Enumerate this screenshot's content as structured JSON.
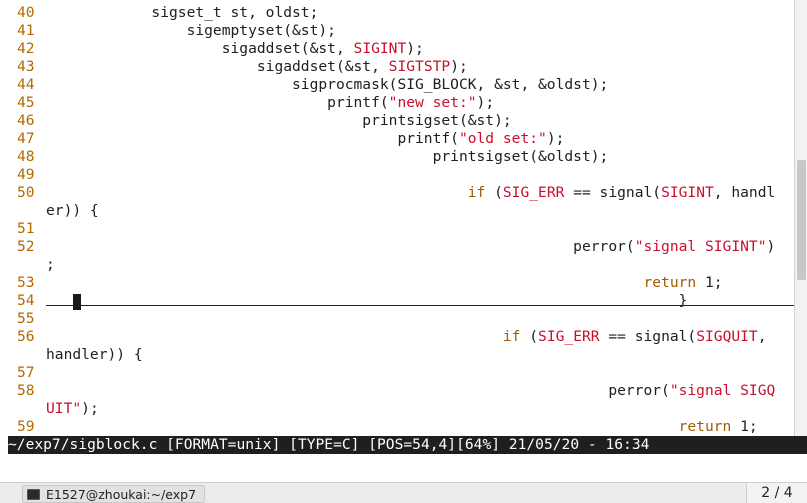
{
  "editor": {
    "lines": [
      {
        "n": "40",
        "parts": [
          {
            "t": "            sigset_t st, oldst;",
            "c": ""
          }
        ]
      },
      {
        "n": "41",
        "parts": [
          {
            "t": "                sigemptyset(&st);",
            "c": ""
          }
        ]
      },
      {
        "n": "42",
        "parts": [
          {
            "t": "                    sigaddset(&st, ",
            "c": ""
          },
          {
            "t": "SIGINT",
            "c": "s"
          },
          {
            "t": ");",
            "c": ""
          }
        ]
      },
      {
        "n": "43",
        "parts": [
          {
            "t": "                        sigaddset(&st, ",
            "c": ""
          },
          {
            "t": "SIGTSTP",
            "c": "s"
          },
          {
            "t": ");",
            "c": ""
          }
        ]
      },
      {
        "n": "44",
        "parts": [
          {
            "t": "                            sigprocmask(SIG_BLOCK, &st, &oldst);",
            "c": ""
          }
        ]
      },
      {
        "n": "45",
        "parts": [
          {
            "t": "                                printf(",
            "c": ""
          },
          {
            "t": "\"new set:\"",
            "c": "s"
          },
          {
            "t": ");",
            "c": ""
          }
        ]
      },
      {
        "n": "46",
        "parts": [
          {
            "t": "                                    printsigset(&st);",
            "c": ""
          }
        ]
      },
      {
        "n": "47",
        "parts": [
          {
            "t": "                                        printf(",
            "c": ""
          },
          {
            "t": "\"old set:\"",
            "c": "s"
          },
          {
            "t": ");",
            "c": ""
          }
        ]
      },
      {
        "n": "48",
        "parts": [
          {
            "t": "                                            printsigset(&oldst);",
            "c": ""
          }
        ]
      },
      {
        "n": "49",
        "parts": []
      },
      {
        "n": "50",
        "parts": [
          {
            "t": "                                                if",
            "c": "k"
          },
          {
            "t": " (",
            "c": ""
          },
          {
            "t": "SIG_ERR",
            "c": "s"
          },
          {
            "t": " == signal(",
            "c": ""
          },
          {
            "t": "SIGINT",
            "c": "s"
          },
          {
            "t": ", handl",
            "c": ""
          }
        ]
      },
      {
        "n": "",
        "parts": [
          {
            "t": "er)) {",
            "c": ""
          }
        ]
      },
      {
        "n": "51",
        "parts": []
      },
      {
        "n": "52",
        "parts": [
          {
            "t": "                                                            perror(",
            "c": ""
          },
          {
            "t": "\"signal SIGINT\"",
            "c": "s"
          },
          {
            "t": ")",
            "c": ""
          }
        ]
      },
      {
        "n": "",
        "parts": [
          {
            "t": ";",
            "c": ""
          }
        ]
      },
      {
        "n": "53",
        "parts": [
          {
            "t": "                                                                    return",
            "c": "r"
          },
          {
            "t": " 1;",
            "c": ""
          }
        ]
      },
      {
        "n": "54",
        "parts": [
          {
            "t": "                                                                        }",
            "c": ""
          }
        ]
      },
      {
        "n": "55",
        "parts": []
      },
      {
        "n": "56",
        "parts": [
          {
            "t": "                                                    if",
            "c": "k"
          },
          {
            "t": " (",
            "c": ""
          },
          {
            "t": "SIG_ERR",
            "c": "s"
          },
          {
            "t": " == signal(",
            "c": ""
          },
          {
            "t": "SIGQUIT",
            "c": "s"
          },
          {
            "t": ",",
            "c": ""
          }
        ]
      },
      {
        "n": "",
        "parts": [
          {
            "t": "handler)) {",
            "c": ""
          }
        ]
      },
      {
        "n": "57",
        "parts": []
      },
      {
        "n": "58",
        "parts": [
          {
            "t": "                                                                perror(",
            "c": ""
          },
          {
            "t": "\"signal SIGQ",
            "c": "s"
          }
        ]
      },
      {
        "n": "",
        "parts": [
          {
            "t": "UIT\"",
            "c": "s"
          },
          {
            "t": ");",
            "c": ""
          }
        ]
      },
      {
        "n": "59",
        "parts": [
          {
            "t": "                                                                        return",
            "c": "r"
          },
          {
            "t": " 1;",
            "c": ""
          }
        ]
      }
    ]
  },
  "statusbar": {
    "text": "~/exp7/sigblock.c [FORMAT=unix] [TYPE=C] [POS=54,4][64%] 21/05/20 - 16:34"
  },
  "taskbar": {
    "task_label": "E1527@zhoukai:~/exp7",
    "workspace": "2 / 4"
  },
  "colors": {
    "line_number": "#b36a00",
    "string_macro": "#c8102e",
    "keyword": "#a35a00",
    "status_bg": "#1f1f1f"
  }
}
